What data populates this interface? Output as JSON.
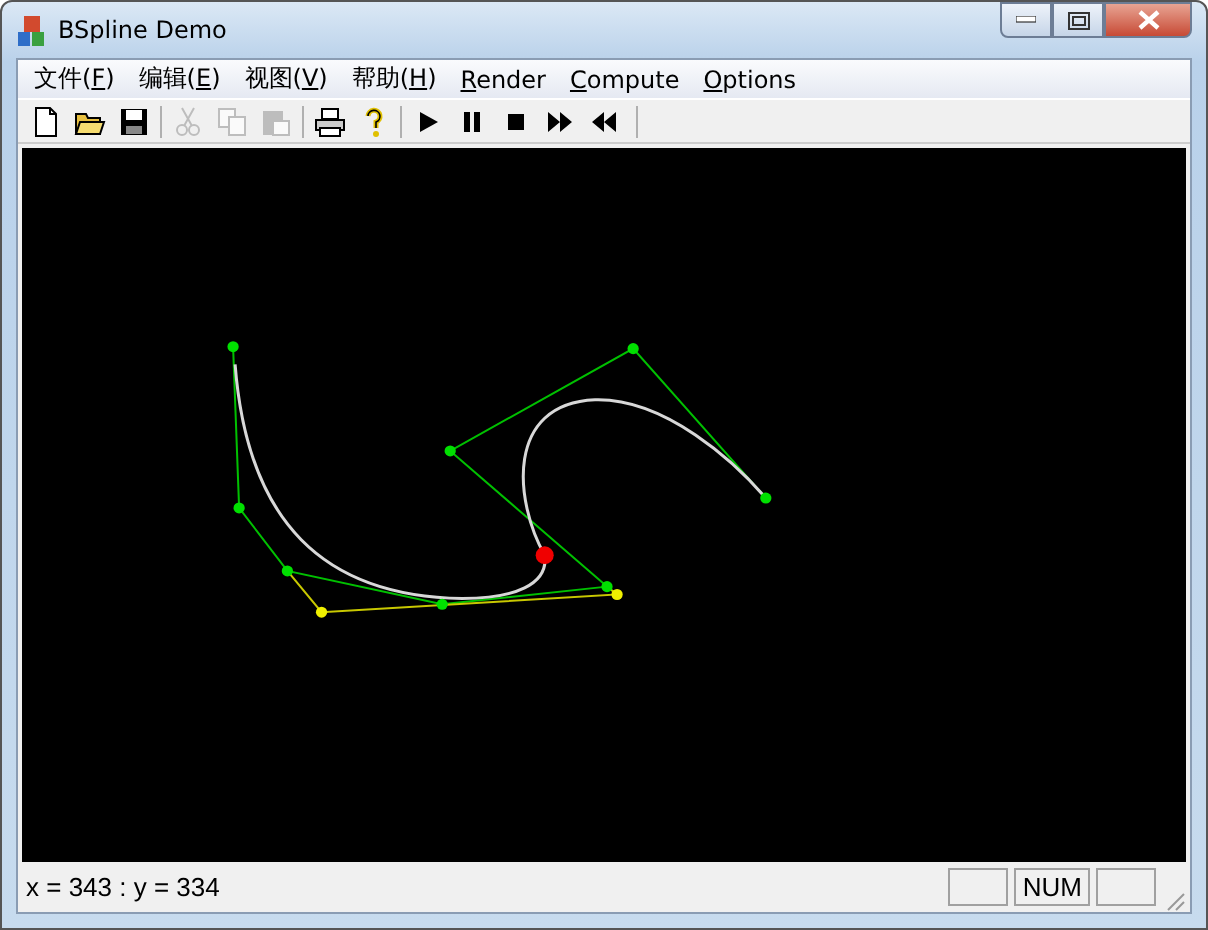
{
  "window": {
    "title": "BSpline Demo"
  },
  "menu": [
    {
      "pre": "文件(",
      "key": "F",
      "post": ")"
    },
    {
      "pre": "编辑(",
      "key": "E",
      "post": ")"
    },
    {
      "pre": "视图(",
      "key": "V",
      "post": ")"
    },
    {
      "pre": "帮助(",
      "key": "H",
      "post": ")"
    },
    {
      "key": "R",
      "post": "ender"
    },
    {
      "key": "C",
      "post": "ompute"
    },
    {
      "key": "O",
      "post": "ptions"
    }
  ],
  "toolbar": [
    [
      {
        "kind": "new",
        "disabled": false
      },
      {
        "kind": "open",
        "disabled": false
      },
      {
        "kind": "save",
        "disabled": false
      }
    ],
    [
      {
        "kind": "cut",
        "disabled": true
      },
      {
        "kind": "copy",
        "disabled": true
      },
      {
        "kind": "paste",
        "disabled": true
      }
    ],
    [
      {
        "kind": "print",
        "disabled": false
      },
      {
        "kind": "help",
        "disabled": false
      }
    ],
    [
      {
        "kind": "play",
        "disabled": false
      },
      {
        "kind": "pause",
        "disabled": false
      },
      {
        "kind": "stop",
        "disabled": false
      },
      {
        "kind": "forward",
        "disabled": false
      },
      {
        "kind": "rewind",
        "disabled": false
      }
    ]
  ],
  "status_bar": {
    "text": "x = 343 : y = 334",
    "indicators": [
      "NUM"
    ]
  }
}
